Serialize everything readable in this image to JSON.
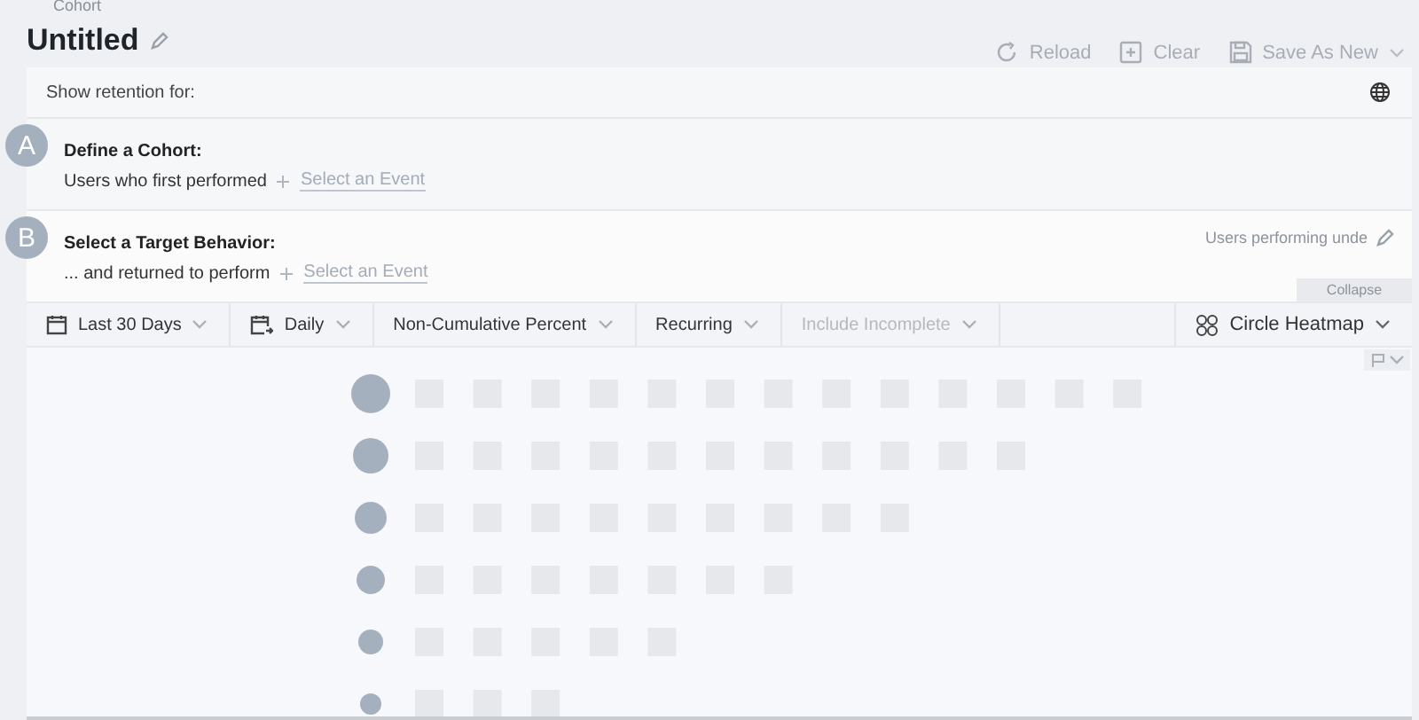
{
  "breadcrumb": "Cohort",
  "title": "Untitled",
  "actions": [
    {
      "label": "Reload",
      "kind": "reload"
    },
    {
      "label": "Clear",
      "kind": "clear"
    },
    {
      "label": "Save As New",
      "kind": "save",
      "menu": true
    }
  ],
  "retention_label": "Show retention for:",
  "steps": [
    {
      "badge": "A",
      "heading": "Define a Cohort:",
      "text": "Users who first performed",
      "link": "Select an Event"
    },
    {
      "badge": "B",
      "heading": "Select a Target Behavior:",
      "text": "... and returned to perform",
      "link": "Select an Event",
      "note": "Users performing unde"
    }
  ],
  "collapse": "Collapse",
  "toolbar": [
    {
      "label": "Last 30 Days",
      "kind": "range",
      "disabled": false
    },
    {
      "label": "Daily",
      "kind": "interval",
      "disabled": false
    },
    {
      "label": "Non-Cumulative Percent",
      "kind": "plain",
      "disabled": false
    },
    {
      "label": "Recurring",
      "kind": "plain",
      "disabled": false
    },
    {
      "label": "Include Incomplete",
      "kind": "plain",
      "disabled": true
    }
  ],
  "view": {
    "label": "Circle Heatmap"
  }
}
